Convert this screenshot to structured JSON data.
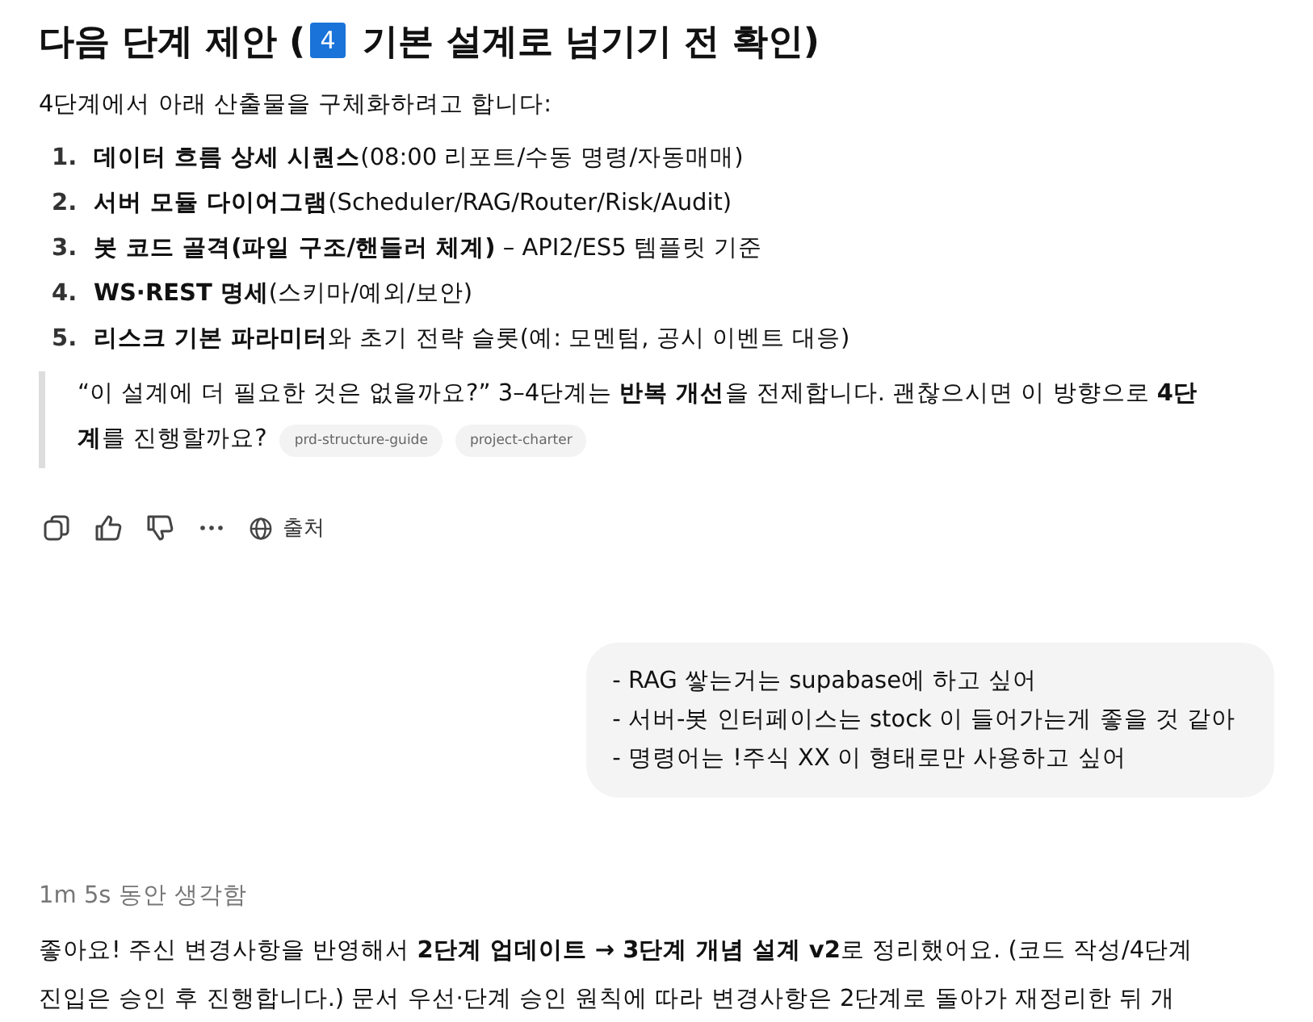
{
  "heading": {
    "before": "다음 단계 제안 (",
    "badge": "4",
    "after": " 기본 설계로 넘기기 전 확인)"
  },
  "intro": "4단계에서 아래 산출물을 구체화하려고 합니다:",
  "steps": [
    {
      "number": "1.",
      "text": "**데이터 흐름 상세 시퀀스**(08:00 리포트/수동 명령/자동매매)"
    },
    {
      "number": "2.",
      "text": "**서버 모듈 다이어그램**(Scheduler/RAG/Router/Risk/Audit)"
    },
    {
      "number": "3.",
      "text": "**봇 코드 골격(파일 구조/핸들러 체계)** – API2/ES5 템플릿 기준"
    },
    {
      "number": "4.",
      "text": "**WS·REST 명세**(스키마/예외/보안)"
    },
    {
      "number": "5.",
      "text": "**리스크 기본 파라미터**와 초기 전략 슬롯(예: 모멘텀, 공시 이벤트 대응)"
    }
  ],
  "quote": {
    "lines": [
      "“이 설계에 더 필요한 것은 없을까요?” 3–4단계는 **반복 개선**을 전제합니다. 괜찮으시면 이 방향으로 **4단**",
      "**계**를 진행할까요?"
    ],
    "sources": [
      "prd-structure-guide",
      "project-charter"
    ]
  },
  "actions": {
    "sources_label": "출처"
  },
  "user_message": [
    "- RAG 쌓는거는 supabase에 하고 싶어",
    "- 서버-봇 인터페이스는 stock 이 들어가는게 좋을 것 같아",
    "- 명령어는 !주식 XX 이 형태로만 사용하고 싶어"
  ],
  "thinking": "1m 5s 동안 생각함",
  "reply": [
    "좋아요! 주신 변경사항을 반영해서 **2단계 업데이트 → 3단계 개념 설계 v2**로 정리했어요. (코드 작성/4단계",
    "진입은 승인 후 진행합니다.) 문서 우선·단계 승인 원칙에 따라 변경사항은 2단계로 돌아가 재정리한 뒤 개"
  ]
}
